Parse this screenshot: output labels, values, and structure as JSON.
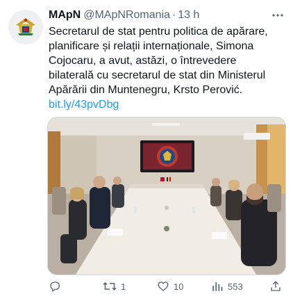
{
  "tweet": {
    "author_name": "MApN",
    "author_handle": "@MApNRomania",
    "separator": "·",
    "time": "13 h",
    "text_lines": [
      "Secretarul de stat pentru politica de apărare,",
      "planificare și relații internaționale, Simona",
      "Cojocaru, a avut, astăzi, o întrevedere",
      "bilaterală cu secretarul de stat din Ministerul",
      "Apărării din Muntenegru, Krsto Perović."
    ],
    "link": "bit.ly/43pvDbg"
  },
  "actions": {
    "reply_icon": "reply-icon",
    "retweet_icon": "retweet-icon",
    "retweet_count": "1",
    "like_icon": "heart-icon",
    "like_count": "10",
    "views_icon": "views-icon",
    "views_count": "553",
    "share_icon": "share-icon"
  },
  "colors": {
    "text": "#0f1419",
    "secondary": "#536471",
    "link": "#1d9bf0"
  }
}
